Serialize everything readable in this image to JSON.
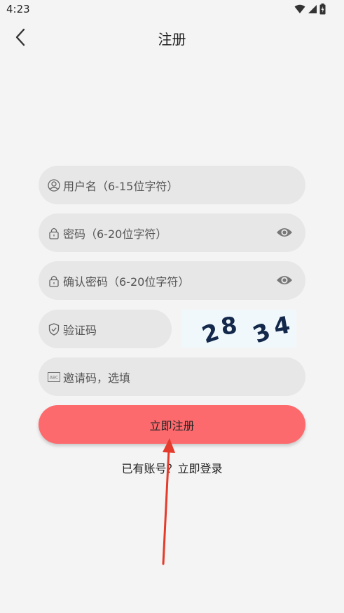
{
  "status_bar": {
    "time": "4:23"
  },
  "header": {
    "title": "注册"
  },
  "form": {
    "username_placeholder": "用户名（6-15位字符）",
    "password_placeholder": "密码（6-20位字符）",
    "confirm_password_placeholder": "确认密码（6-20位字符）",
    "captcha_placeholder": "验证码",
    "captcha_text": "28 34",
    "invite_placeholder": "邀请码，选填"
  },
  "actions": {
    "register_label": "立即注册",
    "have_account_label": "已有账号？",
    "login_link_label": "立即登录"
  },
  "colors": {
    "accent": "#fd6a6d",
    "field_bg": "#e7e7e7",
    "annotation_arrow": "#e53b2c"
  }
}
